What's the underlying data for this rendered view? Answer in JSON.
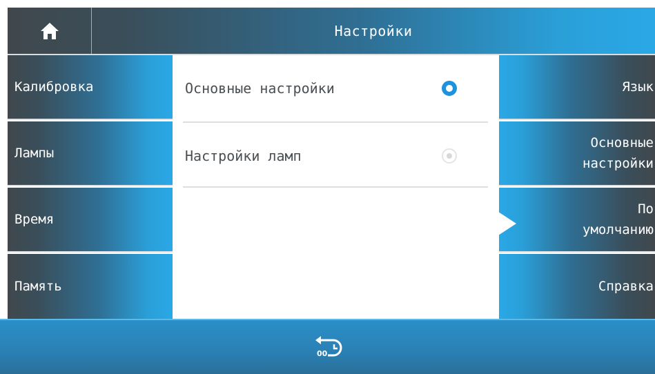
{
  "header": {
    "title": "Настройки",
    "home_icon": "home-icon"
  },
  "left_nav": {
    "items": [
      {
        "label": "Калибровка"
      },
      {
        "label": "Лампы"
      },
      {
        "label": "Время"
      },
      {
        "label": "Память"
      }
    ]
  },
  "center": {
    "options": [
      {
        "label": "Основные настройки",
        "selected": true
      },
      {
        "label": "Настройки ламп",
        "selected": false
      }
    ]
  },
  "right_nav": {
    "items": [
      {
        "line1": "Язык",
        "line2": ""
      },
      {
        "line1": "Основные",
        "line2": "настройки"
      },
      {
        "line1": "По",
        "line2": "умолчанию"
      },
      {
        "line1": "Справка",
        "line2": ""
      }
    ]
  },
  "footer": {
    "back_icon": "back-timer-icon",
    "back_text": "00"
  },
  "colors": {
    "accent": "#2aa8e6",
    "dark": "#40484d",
    "radio": "#1e93dd"
  }
}
